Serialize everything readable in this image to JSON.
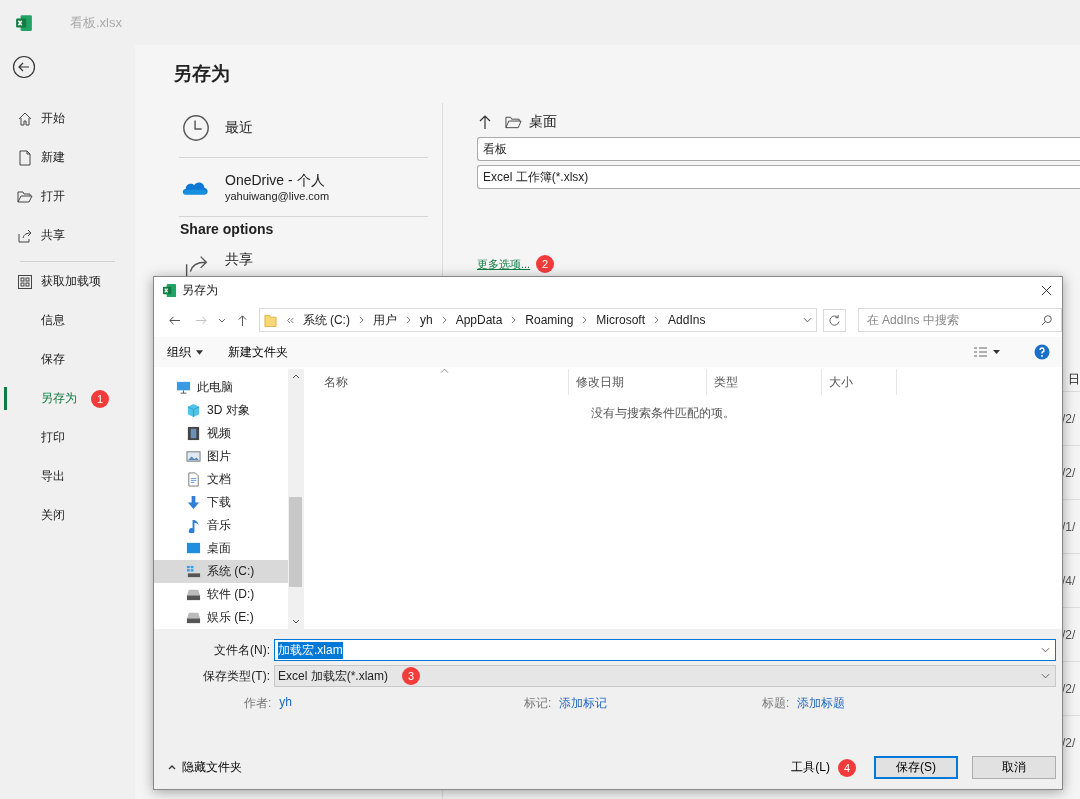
{
  "app": {
    "file_title": "看板.xlsx"
  },
  "backstage_nav": [
    {
      "items": [
        {
          "label": "开始",
          "kind": "home",
          "selected": false
        },
        {
          "label": "新建",
          "kind": "new",
          "selected": false
        },
        {
          "label": "打开",
          "kind": "open",
          "selected": false
        },
        {
          "label": "共享",
          "kind": "share",
          "selected": false
        }
      ]
    },
    {
      "items": [
        {
          "label": "获取加载项",
          "kind": "addins",
          "selected": false
        },
        {
          "label": "信息",
          "kind": "plain",
          "selected": false
        },
        {
          "label": "保存",
          "kind": "plain",
          "selected": false
        },
        {
          "label": "另存为",
          "kind": "plain",
          "selected": true,
          "marker": "1"
        },
        {
          "label": "打印",
          "kind": "plain",
          "selected": false
        },
        {
          "label": "导出",
          "kind": "plain",
          "selected": false
        },
        {
          "label": "关闭",
          "kind": "plain",
          "selected": false
        }
      ]
    }
  ],
  "page_title": "另存为",
  "locations": [
    {
      "kind": "recent",
      "label": "最近"
    },
    {
      "kind": "onedrive",
      "label": "OneDrive - 个人",
      "sub": "yahuiwang@live.com"
    }
  ],
  "share_options": {
    "heading": "Share options",
    "items": [
      {
        "label": "共享"
      }
    ]
  },
  "save_panel": {
    "folder": "桌面",
    "file_name": "看板",
    "file_type": "Excel 工作簿(*.xlsx)",
    "more_link": "更多选项...",
    "marker": "2"
  },
  "recent_files": {
    "header": "日",
    "rows": [
      "/2/",
      "/2/",
      "/1/",
      "/4/",
      "/2/",
      "/2/",
      "/2/"
    ]
  },
  "dialog": {
    "title": "另存为",
    "address": [
      "系统 (C:)",
      "用户",
      "yh",
      "AppData",
      "Roaming",
      "Microsoft",
      "AddIns"
    ],
    "search": {
      "placeholder": "在 AddIns 中搜索"
    },
    "toolbar": {
      "organize": "组织",
      "new_folder": "新建文件夹"
    },
    "tree": [
      {
        "label": "此电脑",
        "kind": "pc",
        "selected": false,
        "children": [
          {
            "label": "3D 对象",
            "kind": "cube",
            "selected": false
          },
          {
            "label": "视频",
            "kind": "film",
            "selected": false
          },
          {
            "label": "图片",
            "kind": "pictures",
            "selected": false
          },
          {
            "label": "文档",
            "kind": "document",
            "selected": false
          },
          {
            "label": "下载",
            "kind": "download",
            "selected": false
          },
          {
            "label": "音乐",
            "kind": "music",
            "selected": false
          },
          {
            "label": "桌面",
            "kind": "desktop",
            "selected": false
          },
          {
            "label": "系统 (C:)",
            "kind": "sysdrive",
            "selected": true
          },
          {
            "label": "软件 (D:)",
            "kind": "drive",
            "selected": false
          },
          {
            "label": "娱乐 (E:)",
            "kind": "drive",
            "selected": false
          }
        ]
      }
    ],
    "columns": [
      "名称",
      "修改日期",
      "类型",
      "大小"
    ],
    "empty_message": "没有与搜索条件匹配的项。",
    "file_name": {
      "label": "文件名(N):",
      "value": "加载宏.xlam",
      "text_selected": true
    },
    "file_type": {
      "label": "保存类型(T):",
      "value": "Excel 加载宏(*.xlam)",
      "marker": "3"
    },
    "meta": [
      {
        "label": "作者:",
        "value": "yh"
      },
      {
        "label": "标记:",
        "value": "添加标记"
      },
      {
        "label": "标题:",
        "value": "添加标题"
      }
    ],
    "hide_folders": "隐藏文件夹",
    "tools": {
      "label": "工具(L)",
      "marker": "4"
    },
    "save_button": "保存(S)",
    "cancel_button": "取消"
  }
}
